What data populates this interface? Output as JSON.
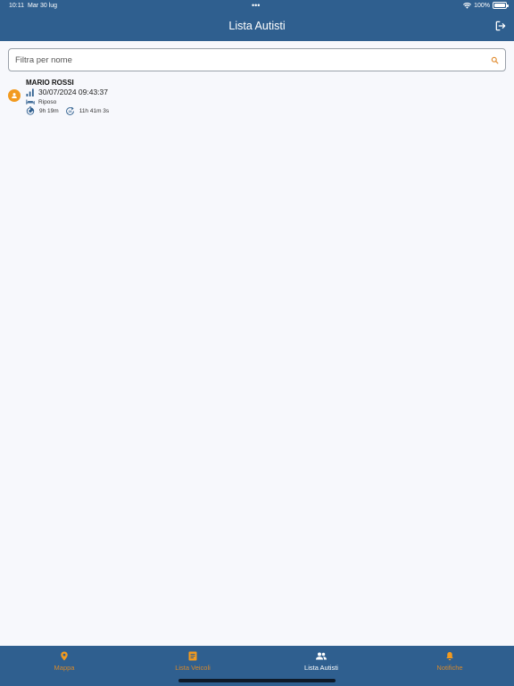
{
  "status_bar": {
    "time": "10:11",
    "date": "Mar 30 lug",
    "battery": "100%"
  },
  "header": {
    "title": "Lista Autisti"
  },
  "search": {
    "placeholder": "Filtra per nome",
    "value": ""
  },
  "drivers": [
    {
      "name": "MARIO ROSSI",
      "datetime": "30/07/2024 09:43:37",
      "status": "Riposo",
      "driving_time": "9h 19m",
      "remaining_time": "11h 41m 3s"
    }
  ],
  "tabs": [
    {
      "label": "Mappa",
      "icon": "map-pin-icon",
      "active": false
    },
    {
      "label": "Lista Veicoli",
      "icon": "list-icon",
      "active": false
    },
    {
      "label": "Lista Autisti",
      "icon": "people-icon",
      "active": true
    },
    {
      "label": "Notifiche",
      "icon": "bell-icon",
      "active": false
    }
  ],
  "colors": {
    "primary": "#2f5f8f",
    "accent": "#f29a1f",
    "background": "#f7f8fc"
  }
}
